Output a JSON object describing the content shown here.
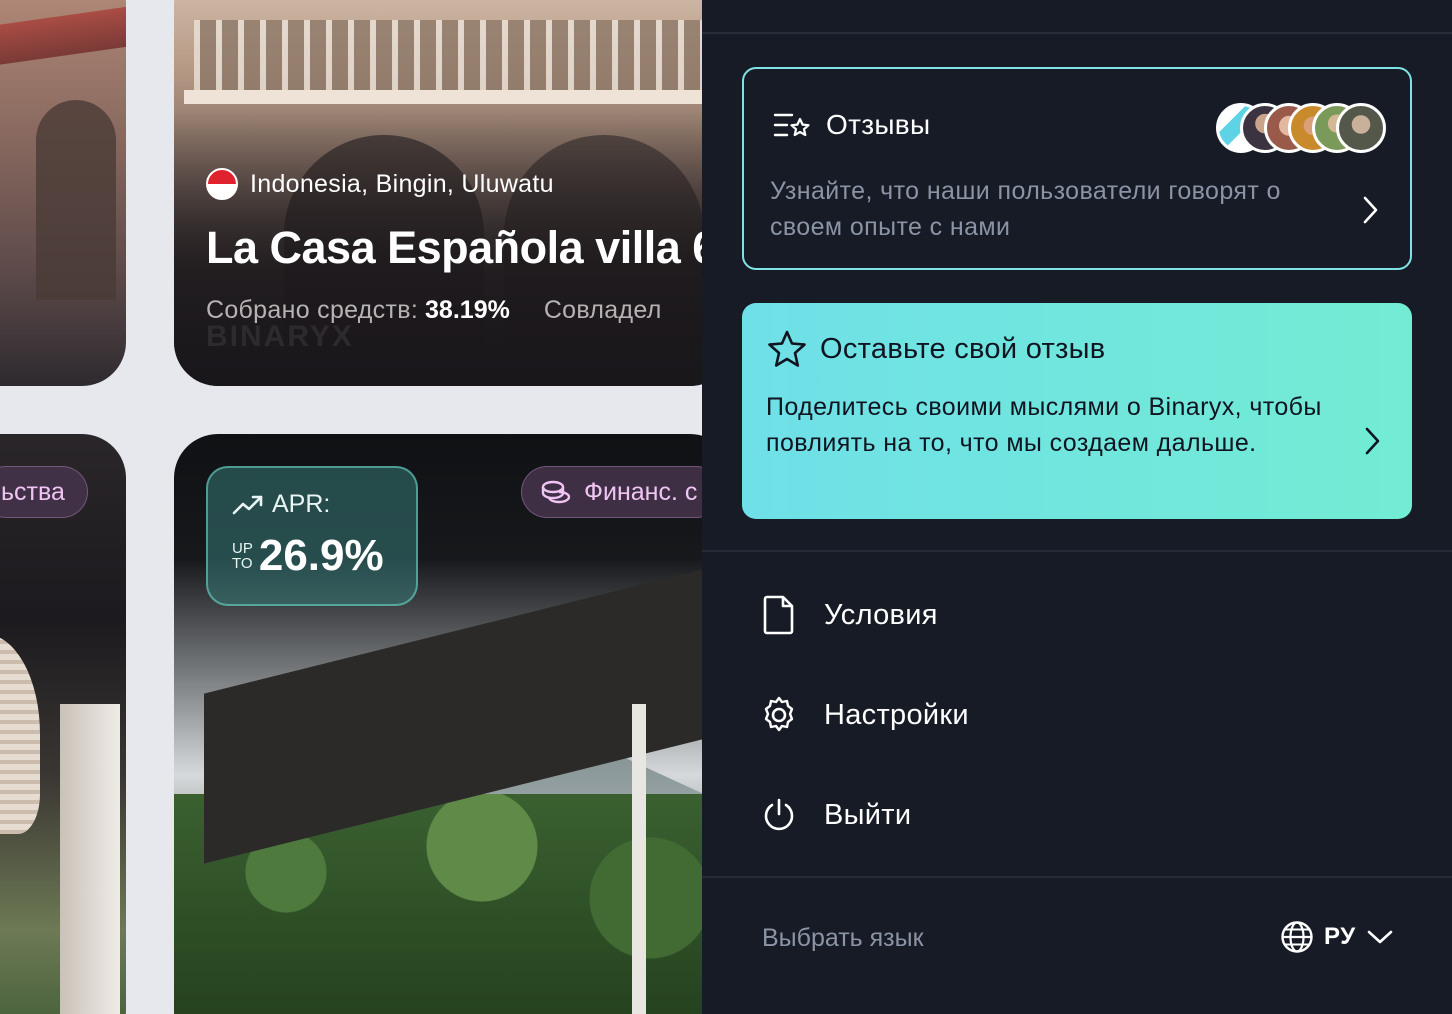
{
  "listing_top": {
    "location": "Indonesia, Bingin, Uluwatu",
    "title": "La Casa Española villa 6",
    "funds_label": "Собрано средств:",
    "funds_value": "38.19%",
    "coowners_label": "Совладел",
    "watermark": "BINARYX"
  },
  "listing_bottom_left": {
    "pill": "ьства"
  },
  "listing_bottom": {
    "apr_label": "APR:",
    "apr_up": "UP",
    "apr_to": "TO",
    "apr_value": "26.9%",
    "pill": "Финанс. с"
  },
  "menu": {
    "reviews": {
      "title": "Отзывы",
      "description": "Узнайте, что наши пользователи говорят о своем опыте с нами"
    },
    "leave_review": {
      "title": "Оставьте свой отзыв",
      "description": "Поделитесь своими мыслями о Binaryx, чтобы повлиять на то, что мы создаем дальше."
    },
    "items": [
      {
        "label": "Условия",
        "icon": "document-icon"
      },
      {
        "label": "Настройки",
        "icon": "gear-icon"
      },
      {
        "label": "Выйти",
        "icon": "power-icon"
      }
    ],
    "language": {
      "label": "Выбрать язык",
      "selected": "РУ"
    }
  },
  "colors": {
    "panel_bg": "#161b26",
    "accent_border": "#7fe3e6",
    "accent_gradient_start": "#6fe0e8",
    "accent_gradient_end": "#72ecd3",
    "muted_text": "#8a94a5"
  }
}
